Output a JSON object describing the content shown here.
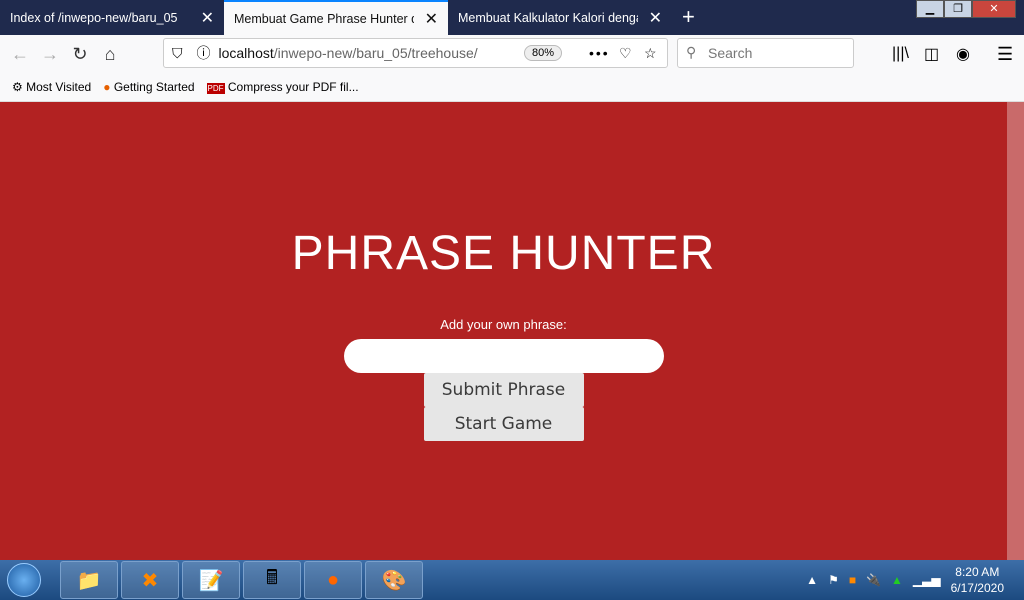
{
  "tabs": [
    {
      "title": "Index of /inwepo-new/baru_05"
    },
    {
      "title": "Membuat Game Phrase Hunter dengan"
    },
    {
      "title": "Membuat Kalkulator Kalori dengan"
    }
  ],
  "nav": {
    "url_host": "localhost",
    "url_path": "/inwepo-new/baru_05/treehouse/",
    "zoom": "80%",
    "search_placeholder": "Search"
  },
  "bookmarks": [
    {
      "label": "Most Visited"
    },
    {
      "label": "Getting Started"
    },
    {
      "label": "Compress your PDF fil..."
    }
  ],
  "page": {
    "title": "PHRASE HUNTER",
    "label": "Add your own phrase:",
    "input_value": "",
    "submit": "Submit Phrase",
    "start": "Start Game"
  },
  "taskbar": {
    "time": "8:20 AM",
    "date": "6/17/2020"
  }
}
